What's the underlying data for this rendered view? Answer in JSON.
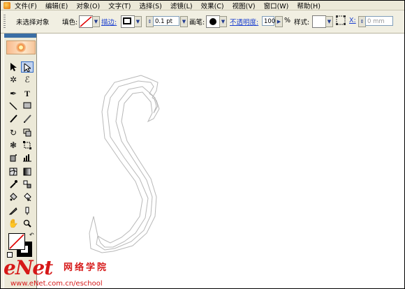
{
  "menubar": {
    "items": [
      "文件(F)",
      "编辑(E)",
      "对象(O)",
      "文字(T)",
      "选择(S)",
      "滤镜(L)",
      "效果(C)",
      "视图(V)",
      "窗口(W)",
      "帮助(H)"
    ]
  },
  "controlbar": {
    "selection_status": "未选择对象",
    "fill_label": "填色:",
    "stroke_label": "描边:",
    "stroke_weight": "0.1 pt",
    "brush_label": "画笔:",
    "opacity_label": "不透明度:",
    "opacity_value": "100",
    "opacity_unit": "%",
    "style_label": "样式:",
    "x_label": "X:",
    "x_value": "0 mm"
  },
  "watermark": {
    "brand": "eNet",
    "tagline": "网络学院",
    "url": "www.eNet.com.cn/eschool"
  },
  "colors": {
    "accent": "#3a6ea5",
    "watermark": "#d61818",
    "link": "#1a3fd0"
  }
}
